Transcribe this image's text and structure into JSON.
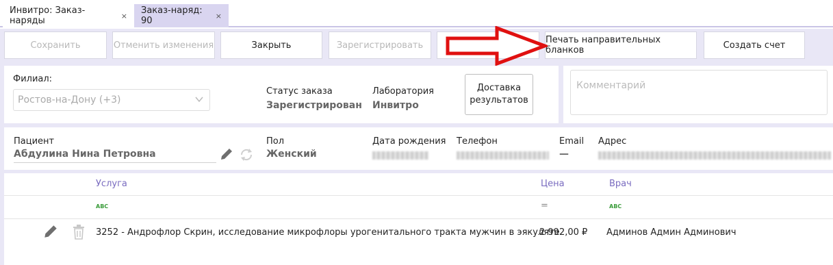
{
  "tabs": [
    {
      "label": "Инвитро: Заказ-наряды",
      "close": "×"
    },
    {
      "label": "Заказ-наряд: 90",
      "close": "×"
    }
  ],
  "toolbar": {
    "save": "Сохранить",
    "cancel": "Отменить изменения",
    "close": "Закрыть",
    "register": "Зарегистрировать",
    "print": "Печать направительных бланков",
    "invoice": "Создать счет"
  },
  "order": {
    "branch_label": "Филиал:",
    "branch_value": "Ростов-на-Дону (+3)",
    "status_label": "Статус заказа",
    "status_value": "Зарегистрирован",
    "lab_label": "Лаборатория",
    "lab_value": "Инвитро",
    "delivery_line1": "Доставка",
    "delivery_line2": "результатов",
    "comment_placeholder": "Комментарий"
  },
  "patient": {
    "label": "Пациент",
    "name": "Абдулина Нина Петровна",
    "sex_label": "Пол",
    "sex_value": "Женский",
    "dob_label": "Дата рождения",
    "phone_label": "Телефон",
    "email_label": "Email",
    "email_value": "—",
    "address_label": "Адрес"
  },
  "services": {
    "col_service": "Услуга",
    "col_price": "Цена",
    "col_doctor": "Врач",
    "filter_abc": "ABC",
    "filter_eq": "=",
    "rows": [
      {
        "service": "3252 - Андрофлор Скрин, исследование микрофлоры урогенитального тракта мужчин в эякуляте",
        "price": "2 992,00 ₽",
        "doctor": "Админов Админ Админович"
      }
    ]
  },
  "colors": {
    "accent": "#7a6cc0",
    "toolbar_bg": "#e9e7f6",
    "active_tab": "#d9d5f0",
    "arrow": "#e01010"
  }
}
